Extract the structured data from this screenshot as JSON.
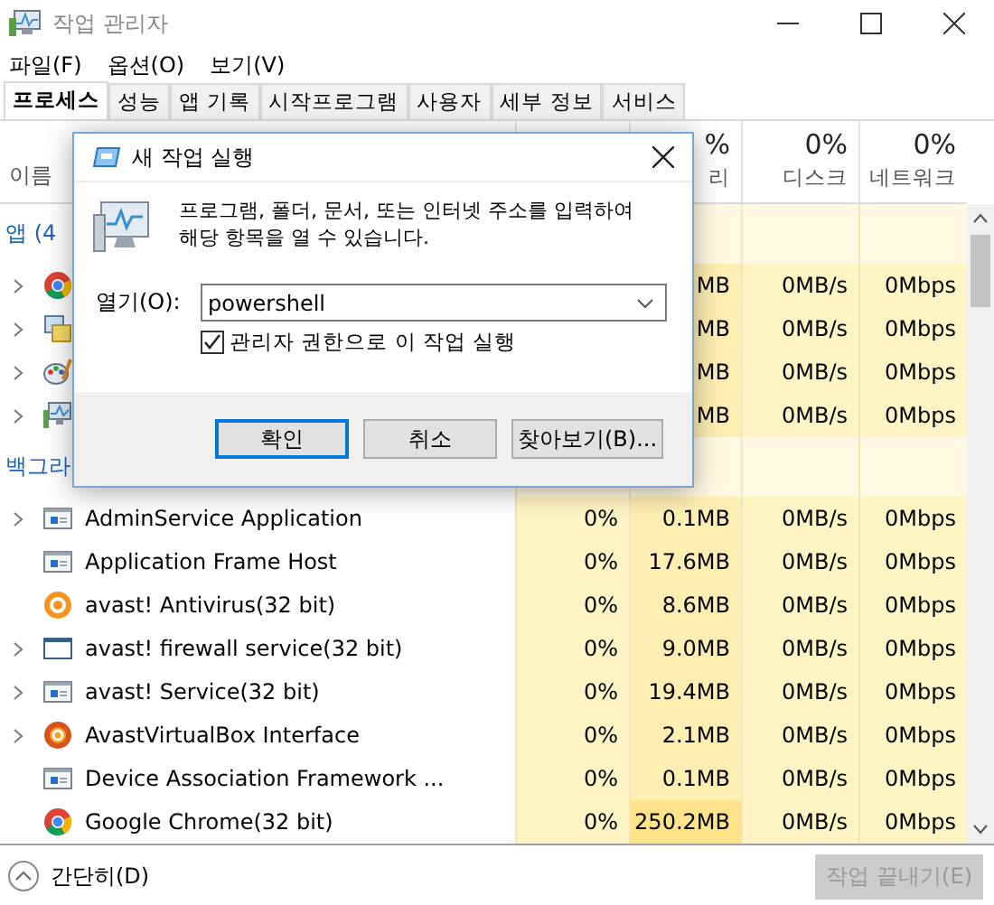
{
  "window": {
    "title": "작업 관리자"
  },
  "menu": [
    "파일(F)",
    "옵션(O)",
    "보기(V)"
  ],
  "tabs": [
    {
      "label": "프로세스",
      "selected": true
    },
    {
      "label": "성능",
      "selected": false
    },
    {
      "label": "앱 기록",
      "selected": false
    },
    {
      "label": "시작프로그램",
      "selected": false
    },
    {
      "label": "사용자",
      "selected": false
    },
    {
      "label": "세부 정보",
      "selected": false
    },
    {
      "label": "서비스",
      "selected": false
    }
  ],
  "name_header": "이름",
  "metric_headers": [
    {
      "percent": "%",
      "label": "리"
    },
    {
      "percent": "0%",
      "label": "디스크"
    },
    {
      "percent": "0%",
      "label": "네트워크"
    }
  ],
  "groups": [
    {
      "title": "앱 (4",
      "rows": [
        {
          "expandable": true,
          "kind": "chrome",
          "memory": "MB",
          "disk": "0MB/s",
          "network": "0Mbps",
          "memory_high": false
        },
        {
          "expandable": true,
          "kind": "windows",
          "memory": "MB",
          "disk": "0MB/s",
          "network": "0Mbps",
          "memory_high": false
        },
        {
          "expandable": true,
          "kind": "paint",
          "memory": "MB",
          "disk": "0MB/s",
          "network": "0Mbps",
          "memory_high": false
        },
        {
          "expandable": true,
          "kind": "monitor",
          "memory": "MB",
          "disk": "0MB/s",
          "network": "0Mbps",
          "memory_high": false
        }
      ]
    },
    {
      "title": "백그라",
      "rows": [
        {
          "expandable": true,
          "kind": "service",
          "name": "AdminService Application",
          "cpu": "0%",
          "memory": "0.1MB",
          "disk": "0MB/s",
          "network": "0Mbps",
          "memory_high": false
        },
        {
          "expandable": false,
          "kind": "service",
          "name": "Application Frame Host",
          "cpu": "0%",
          "memory": "17.6MB",
          "disk": "0MB/s",
          "network": "0Mbps",
          "memory_high": false
        },
        {
          "expandable": false,
          "kind": "avast",
          "name": "avast! Antivirus(32 bit)",
          "cpu": "0%",
          "memory": "8.6MB",
          "disk": "0MB/s",
          "network": "0Mbps",
          "memory_high": false
        },
        {
          "expandable": true,
          "kind": "window",
          "name": "avast! firewall service(32 bit)",
          "cpu": "0%",
          "memory": "9.0MB",
          "disk": "0MB/s",
          "network": "0Mbps",
          "memory_high": false
        },
        {
          "expandable": true,
          "kind": "service",
          "name": "avast! Service(32 bit)",
          "cpu": "0%",
          "memory": "19.4MB",
          "disk": "0MB/s",
          "network": "0Mbps",
          "memory_high": false
        },
        {
          "expandable": true,
          "kind": "avast-box",
          "name": "AvastVirtualBox Interface",
          "cpu": "0%",
          "memory": "2.1MB",
          "disk": "0MB/s",
          "network": "0Mbps",
          "memory_high": false
        },
        {
          "expandable": false,
          "kind": "service",
          "name": "Device Association Framework ...",
          "cpu": "0%",
          "memory": "0.1MB",
          "disk": "0MB/s",
          "network": "0Mbps",
          "memory_high": false
        },
        {
          "expandable": false,
          "kind": "chrome",
          "name": "Google Chrome(32 bit)",
          "cpu": "0%",
          "memory": "250.2MB",
          "disk": "0MB/s",
          "network": "0Mbps",
          "memory_high": true
        }
      ]
    }
  ],
  "footer": {
    "collapse": "간단히(D)",
    "end_task": {
      "label": "작업 끝내기(E)",
      "disabled": true
    }
  },
  "dialog": {
    "title": "새 작업 실행",
    "prompt": "프로그램, 폴더, 문서, 또는 인터넷 주소를 입력하여 해당 항목을 열 수 있습니다.",
    "open_label": "열기(O):",
    "value": "powershell",
    "checkbox": {
      "label": "관리자 권한으로 이 작업 실행",
      "checked": true
    },
    "buttons": [
      {
        "label": "확인",
        "default": true
      },
      {
        "label": "취소",
        "default": false
      },
      {
        "label": "찾아보기(B)...",
        "default": false
      }
    ]
  }
}
